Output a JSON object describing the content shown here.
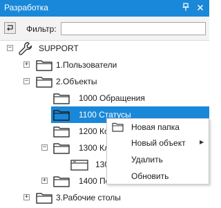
{
  "window": {
    "title": "Разработка",
    "pin_icon": "pin-icon",
    "close_icon": "close-icon"
  },
  "filter": {
    "label": "Фильтр:",
    "value": "",
    "refresh_icon": "refresh-icon"
  },
  "tree": {
    "root": {
      "label": "SUPPORT",
      "icon": "wrench-icon",
      "expanded": true
    },
    "items": [
      {
        "label": "1.Пользователи",
        "expanded": false
      },
      {
        "label": "2.Объекты",
        "expanded": true
      },
      {
        "label": "1000 Обращения"
      },
      {
        "label": "1100 Статусы",
        "selected": true
      },
      {
        "label": "1200 Ко"
      },
      {
        "label": "1300 Кл",
        "expanded": true
      },
      {
        "label": "130"
      },
      {
        "label": "1400 По",
        "expanded": false
      },
      {
        "label": "3.Рабочие столы",
        "expanded": false
      }
    ]
  },
  "context_menu": {
    "items": [
      {
        "label": "Новая папка",
        "icon": "folder-icon"
      },
      {
        "label": "Новый объект",
        "has_submenu": true
      },
      {
        "label": "Удалить"
      },
      {
        "label": "Обновить"
      }
    ]
  },
  "colors": {
    "accent": "#1a88d9",
    "folder_stroke": "#3c3c3c"
  }
}
